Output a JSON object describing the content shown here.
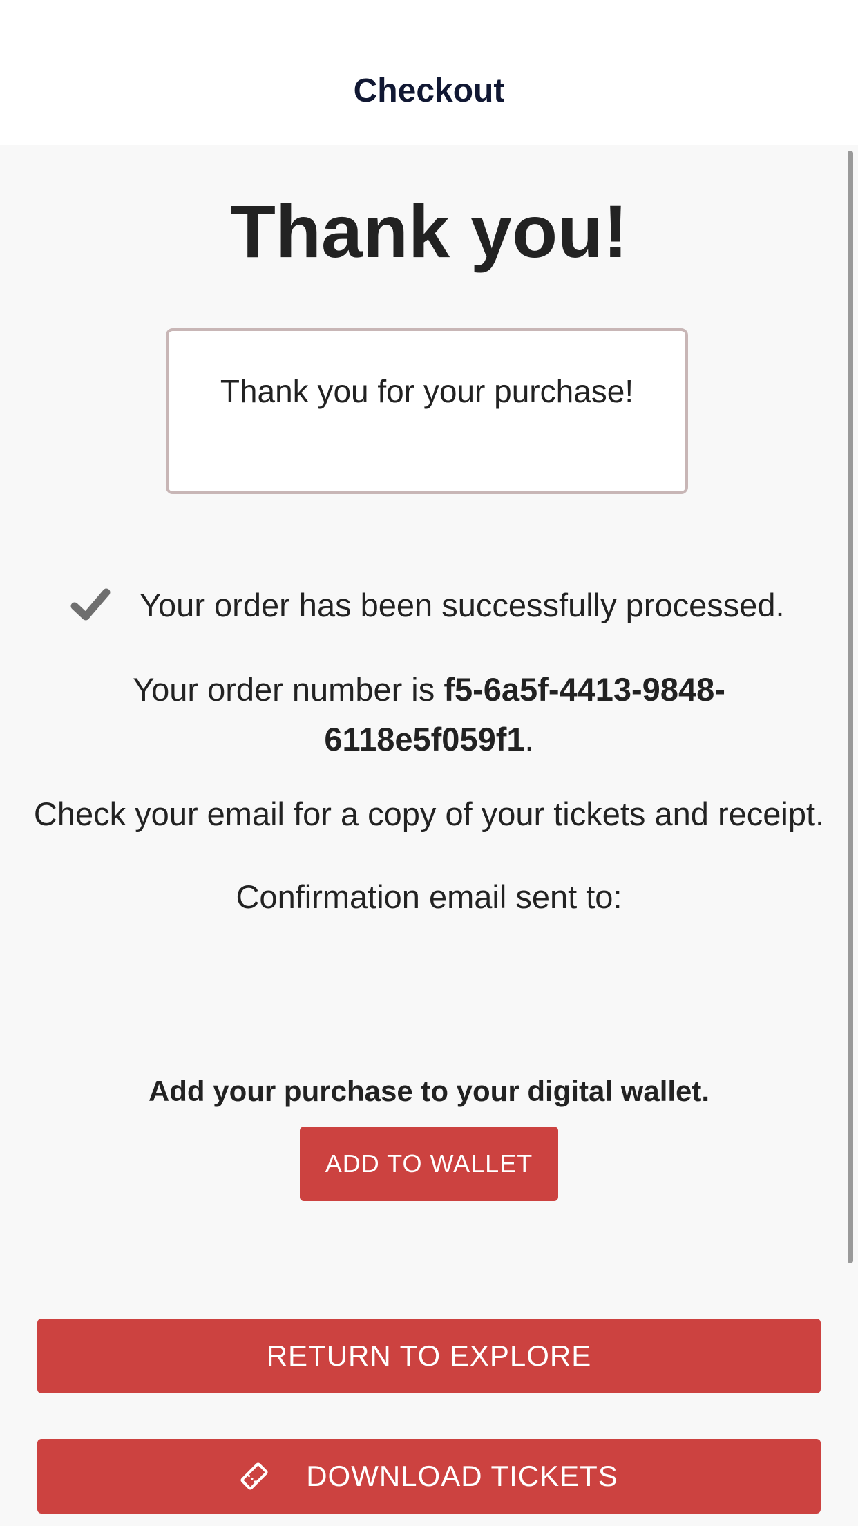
{
  "header": {
    "title": "Checkout"
  },
  "confirmation": {
    "heading": "Thank you!",
    "message": "Thank you for your purchase!",
    "status_text": "Your order has been successfully processed.",
    "order_prefix": "Your order number is ",
    "order_number": "f5-6a5f-4413-9848-6118e5f059f1",
    "order_suffix": ".",
    "email_note": "Check your email for a copy of your tickets and receipt.",
    "confirmation_label": "Confirmation email sent to:",
    "confirmation_email": ""
  },
  "wallet": {
    "prompt": "Add your purchase to your digital wallet.",
    "button_label": "ADD TO WALLET"
  },
  "actions": {
    "return_label": "RETURN TO EXPLORE",
    "download_label": "DOWNLOAD TICKETS"
  },
  "icons": {
    "status": "check-icon",
    "download": "ticket-icon"
  },
  "colors": {
    "accent": "#cc4240",
    "header_text": "#111833",
    "background": "#f8f8f8",
    "box_border": "#c8b6b6"
  }
}
